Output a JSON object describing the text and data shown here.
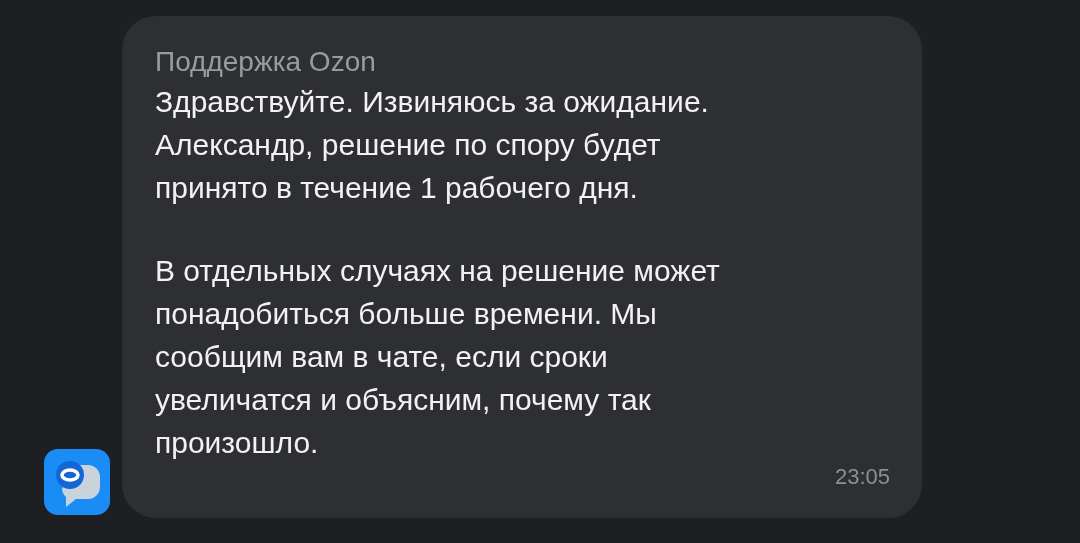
{
  "message": {
    "sender": "Поддержка Ozon",
    "paragraphs": [
      "Здравствуйте. Извиняюсь за ожидание. Александр, решение по спору будет принято в течение 1 рабочего дня.",
      "В отдельных случаях на решение может понадобиться больше времени. Мы сообщим вам в чате, если сроки увеличатся и объясним, почему так произошло."
    ],
    "time": "23:05"
  }
}
